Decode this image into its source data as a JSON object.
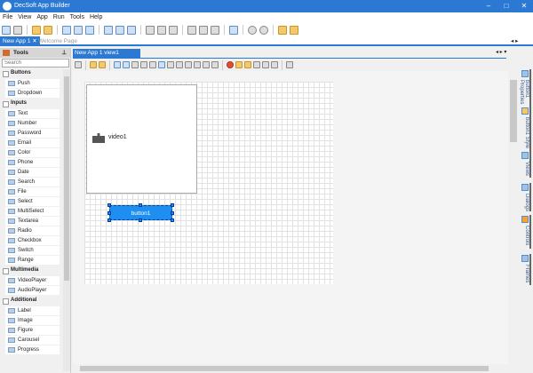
{
  "window": {
    "title": "DecSoft App Builder"
  },
  "menu": [
    "File",
    "View",
    "App",
    "Run",
    "Tools",
    "Help"
  ],
  "doc_tabs": [
    {
      "label": "New App 1",
      "active": true
    },
    {
      "label": "Welcome Page",
      "active": false
    }
  ],
  "tools_panel": {
    "title": "Tools",
    "search_placeholder": "Search",
    "categories": [
      {
        "name": "Buttons",
        "items": [
          "Push",
          "Dropdown"
        ]
      },
      {
        "name": "Inputs",
        "items": [
          "Text",
          "Number",
          "Password",
          "Email",
          "Color",
          "Phone",
          "Date",
          "Search",
          "File",
          "Select",
          "MultiSelect",
          "Textarea",
          "Radio",
          "Checkbox",
          "Switch",
          "Range"
        ]
      },
      {
        "name": "Multimedia",
        "items": [
          "VideoPlayer",
          "AudioPlayer"
        ]
      },
      {
        "name": "Additional",
        "items": [
          "Label",
          "Image",
          "Figure",
          "Carousel",
          "Progress"
        ]
      }
    ]
  },
  "designer": {
    "tab": "New App 1 view1 Designer",
    "video_label": "video1",
    "button_label": "button1"
  },
  "right_tabs": [
    "button1 Properties",
    "button1 Style",
    "Views",
    "Dialogs",
    "Controls",
    "Frames"
  ],
  "colors": {
    "accent": "#2b79d3",
    "button": "#1e8ff0"
  }
}
